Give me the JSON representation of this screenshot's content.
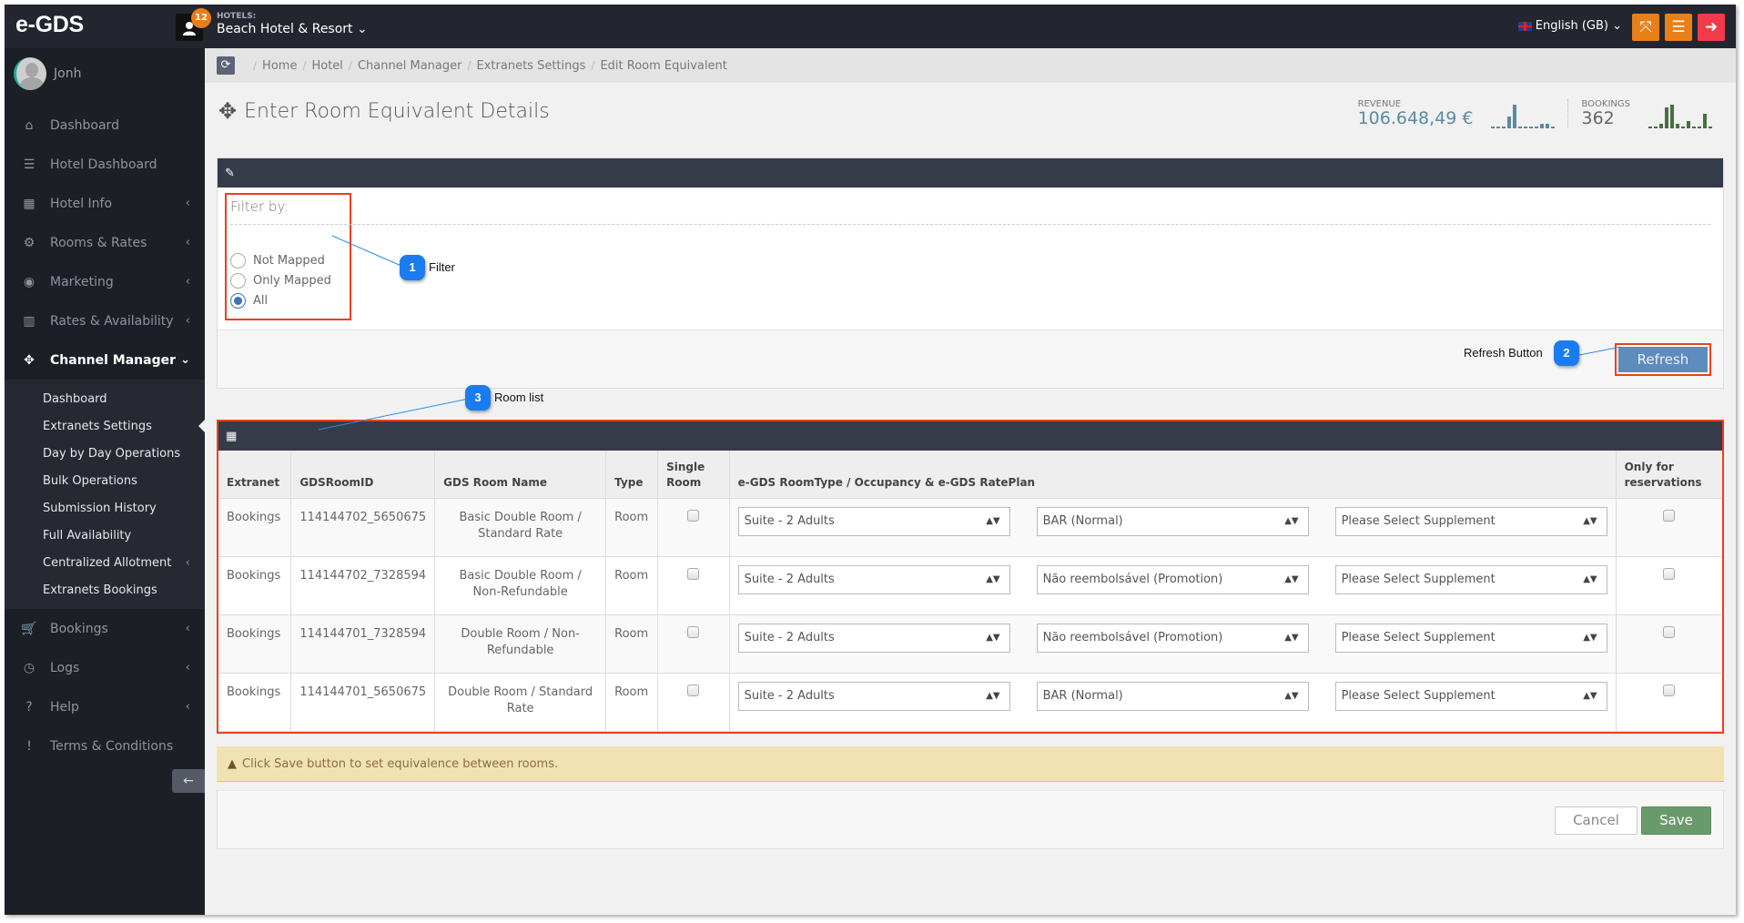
{
  "header": {
    "logo": "e-GDS",
    "notification_count": "12",
    "hotel_label": "HOTELS:",
    "hotel_name": "Beach Hotel & Resort ⌄",
    "language": "English (GB) ⌄",
    "icons": {
      "expand": "expand-icon",
      "menu": "hamburger-icon",
      "logout": "sign-out-icon"
    }
  },
  "sidebar": {
    "user_name": "Jonh",
    "items": [
      {
        "label": "Dashboard",
        "icon": "⌂",
        "chevron": ""
      },
      {
        "label": "Hotel Dashboard",
        "icon": "☰",
        "chevron": ""
      },
      {
        "label": "Hotel Info",
        "icon": "▦",
        "chevron": "‹"
      },
      {
        "label": "Rooms & Rates",
        "icon": "⚙",
        "chevron": "‹"
      },
      {
        "label": "Marketing",
        "icon": "◉",
        "chevron": "‹"
      },
      {
        "label": "Rates & Availability",
        "icon": "▥",
        "chevron": "‹"
      },
      {
        "label": "Channel Manager",
        "icon": "✥",
        "chevron": "⌄"
      }
    ],
    "sub_items": [
      {
        "label": "Dashboard",
        "chevron": ""
      },
      {
        "label": "Extranets Settings",
        "chevron": ""
      },
      {
        "label": "Day by Day Operations",
        "chevron": ""
      },
      {
        "label": "Bulk Operations",
        "chevron": ""
      },
      {
        "label": "Submission History",
        "chevron": ""
      },
      {
        "label": "Full Availability",
        "chevron": ""
      },
      {
        "label": "Centralized Allotment",
        "chevron": "‹"
      },
      {
        "label": "Extranets Bookings",
        "chevron": ""
      }
    ],
    "bottom_items": [
      {
        "label": "Bookings",
        "icon": "🛒",
        "chevron": "‹"
      },
      {
        "label": "Logs",
        "icon": "◷",
        "chevron": "‹"
      },
      {
        "label": "Help",
        "icon": "?",
        "chevron": "‹"
      },
      {
        "label": "Terms & Conditions",
        "icon": "!",
        "chevron": ""
      }
    ],
    "collapse_icon": "←"
  },
  "breadcrumb": [
    "Home",
    "Hotel",
    "Channel Manager",
    "Extranets Settings",
    "Edit Room Equivalent"
  ],
  "page_title": "Enter Room Equivalent Details",
  "stats": {
    "revenue": {
      "label": "REVENUE",
      "value": "106.648,49 €",
      "color": "#5b8ba0",
      "spark": [
        0.05,
        0.05,
        0.05,
        0.5,
        1.0,
        0.05,
        0.05,
        0.05,
        0.05,
        0.2,
        0.2,
        0.05
      ]
    },
    "bookings": {
      "label": "BOOKINGS",
      "value": "362",
      "color": "#4a6e44",
      "spark": [
        0.05,
        0.05,
        0.2,
        0.9,
        1.0,
        0.2,
        0.05,
        0.3,
        0.05,
        0.05,
        0.6,
        0.05
      ]
    }
  },
  "filter": {
    "title": "Filter by:",
    "options": [
      {
        "label": "Not Mapped",
        "selected": false
      },
      {
        "label": "Only Mapped",
        "selected": false
      },
      {
        "label": "All",
        "selected": true
      }
    ],
    "refresh_label": "Refresh"
  },
  "callouts": [
    {
      "num": "1",
      "label": "Filter"
    },
    {
      "num": "2",
      "label": "Refresh Button"
    },
    {
      "num": "3",
      "label": "Room list"
    }
  ],
  "table": {
    "headers": [
      "Extranet",
      "GDSRoomID",
      "GDS Room Name",
      "Type",
      "Single Room",
      "e-GDS RoomType / Occupancy & e-GDS RatePlan",
      "Only for reservations"
    ],
    "rows": [
      {
        "extranet": "Bookings",
        "room_id": "114144702_5650675",
        "room_name": "Basic Double Room / Standard Rate",
        "type": "Room",
        "room_type": "Suite - 2 Adults",
        "rate_plan": "BAR (Normal)",
        "supplement": "Please Select Supplement"
      },
      {
        "extranet": "Bookings",
        "room_id": "114144702_7328594",
        "room_name": "Basic Double Room / Non-Refundable",
        "type": "Room",
        "room_type": "Suite - 2 Adults",
        "rate_plan": "Não reembolsável (Promotion)",
        "supplement": "Please Select Supplement"
      },
      {
        "extranet": "Bookings",
        "room_id": "114144701_7328594",
        "room_name": "Double Room / Non-Refundable",
        "type": "Room",
        "room_type": "Suite - 2 Adults",
        "rate_plan": "Não reembolsável (Promotion)",
        "supplement": "Please Select Supplement"
      },
      {
        "extranet": "Bookings",
        "room_id": "114144701_5650675",
        "room_name": "Double Room / Standard Rate",
        "type": "Room",
        "room_type": "Suite - 2 Adults",
        "rate_plan": "BAR (Normal)",
        "supplement": "Please Select Supplement"
      }
    ]
  },
  "warning": "Click Save button to set equivalence between rooms.",
  "actions": {
    "cancel": "Cancel",
    "save": "Save"
  }
}
